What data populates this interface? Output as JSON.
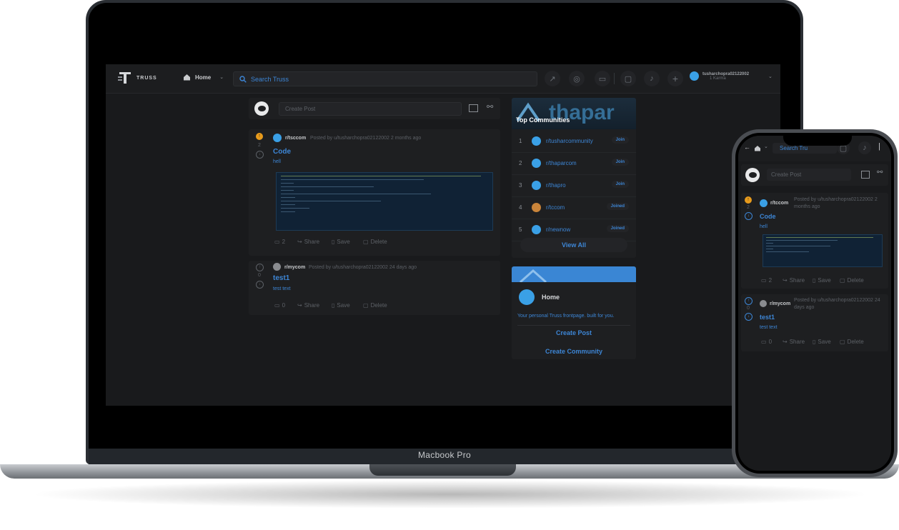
{
  "device_label": "Macbook Pro",
  "app": {
    "logo_text": "TRUSS",
    "home_label": "Home",
    "search_placeholder": "Search Truss",
    "user_name": "tusharchopra02122002",
    "user_karma": "1 Karma"
  },
  "create_post": {
    "placeholder": "Create Post"
  },
  "posts": [
    {
      "community": "r/tsccom",
      "meta": "Posted by u/tusharchopra02122002 2 months ago",
      "votes": "2",
      "title": "Code",
      "body": "hell",
      "comments": "2",
      "share": "Share",
      "save": "Save",
      "delete": "Delete"
    },
    {
      "community": "r/mycom",
      "meta": "Posted by u/tusharchopra02122002 24 days ago",
      "votes": "0",
      "title": "test1",
      "body": "test text",
      "comments": "0",
      "share": "Share",
      "save": "Save",
      "delete": "Delete"
    }
  ],
  "sidebar": {
    "banner_text": "thapar",
    "top_title": "Top Communities",
    "communities": [
      {
        "rank": "1",
        "name": "r/tusharcommunity",
        "action": "Join"
      },
      {
        "rank": "2",
        "name": "r/thaparcom",
        "action": "Join"
      },
      {
        "rank": "3",
        "name": "r/thapro",
        "action": "Join"
      },
      {
        "rank": "4",
        "name": "r/tccom",
        "action": "Joined"
      },
      {
        "rank": "5",
        "name": "r/newnow",
        "action": "Joined"
      }
    ],
    "view_all": "View All",
    "home_title": "Home",
    "home_desc": "Your personal Truss frontpage. built for you.",
    "create_post": "Create Post",
    "create_community": "Create Community"
  },
  "phone": {
    "search_placeholder": "Search Tru",
    "create_post": "Create Post",
    "posts": [
      {
        "community": "r/tccom",
        "meta": "Posted by u/tusharchopra02122002 2 months ago",
        "votes": "2",
        "title": "Code",
        "body": "hell",
        "comments": "2",
        "share": "Share",
        "save": "Save",
        "delete": "Delete"
      },
      {
        "community": "r/mycom",
        "meta": "Posted by u/tusharchopra02122002 24 days ago",
        "votes": "0",
        "title": "test1",
        "body": "test text",
        "comments": "0",
        "share": "Share",
        "save": "Save",
        "delete": "Delete"
      }
    ]
  }
}
